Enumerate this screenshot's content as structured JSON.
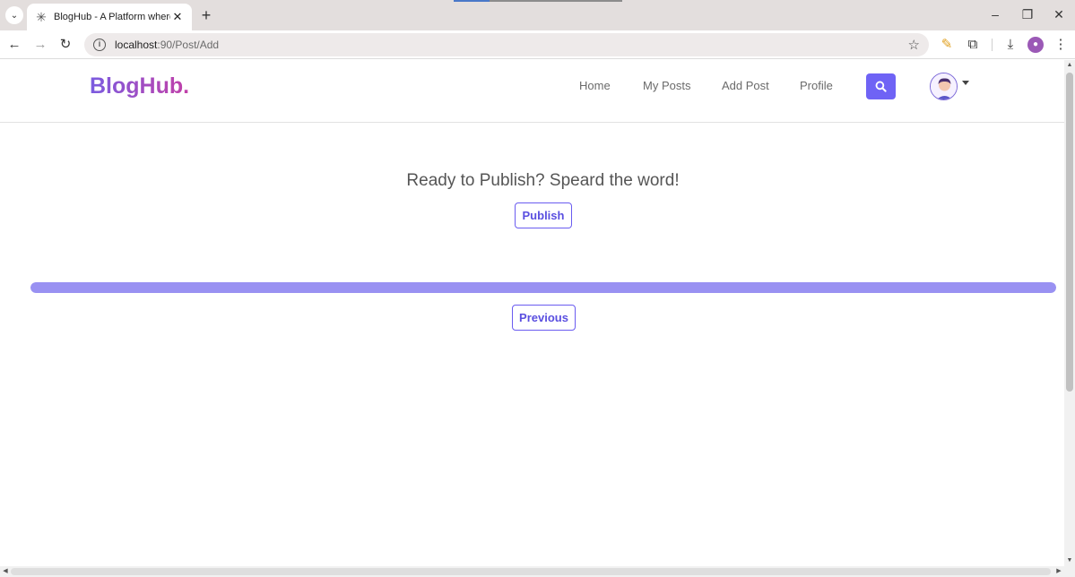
{
  "browser": {
    "tab_title": "BlogHub - A Platform where yo",
    "url_host": "localhost",
    "url_path": ":90/Post/Add",
    "icons": {
      "tab_search": "chevron-down-icon",
      "favicon": "bloghub-favicon",
      "tab_close": "close-icon",
      "new_tab": "plus-icon",
      "back": "arrow-left-icon",
      "forward": "arrow-right-icon",
      "reload": "reload-icon",
      "site_info": "info-icon",
      "bookmark": "star-icon",
      "pen": "pen-icon",
      "extensions": "puzzle-icon",
      "downloads": "download-icon",
      "profile": "profile-icon",
      "menu": "kebab-menu-icon",
      "minimize": "minimize-icon",
      "restore": "restore-icon",
      "close_window": "close-icon"
    }
  },
  "navbar": {
    "brand": "BlogHub.",
    "links": [
      "Home",
      "My Posts",
      "Add Post",
      "Profile"
    ],
    "search_icon": "search-icon",
    "avatar_icon": "user-avatar",
    "colors": {
      "brand_gradient_start": "#7b5ce0",
      "brand_gradient_end": "#c23fa8",
      "accent": "#6f63f5"
    }
  },
  "main": {
    "heading": "Ready to Publish? Speard the word!",
    "publish_label": "Publish",
    "previous_label": "Previous",
    "progress_fraction": 1.0,
    "colors": {
      "progress": "#9991f2",
      "button_border": "#6a5cf0"
    }
  }
}
